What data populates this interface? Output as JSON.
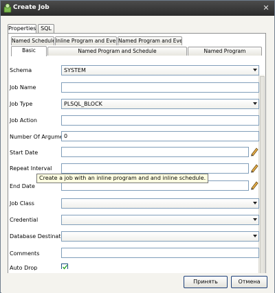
{
  "window": {
    "title": "Create Job",
    "close_symbol": "✕"
  },
  "top_tabs": [
    {
      "label": "Properties",
      "active": true
    },
    {
      "label": "SQL",
      "active": false
    }
  ],
  "inner_tabs_row1": [
    "Named Schedule",
    "Inline Program and Event",
    "Named Program and Event"
  ],
  "inner_tabs_row2": [
    {
      "label": "Basic",
      "active": true
    },
    {
      "label": "Named Program and Schedule",
      "active": false
    },
    {
      "label": "Named Program",
      "active": false
    }
  ],
  "form": {
    "schema": {
      "label": "Schema",
      "value": "SYSTEM"
    },
    "job_name": {
      "label": "Job Name",
      "value": ""
    },
    "job_type": {
      "label": "Job Type",
      "value": "PLSQL_BLOCK"
    },
    "job_action": {
      "label": "Job Action",
      "value": ""
    },
    "num_args": {
      "label": "Number Of Arguments",
      "value": "0"
    },
    "start_date": {
      "label": "Start Date",
      "value": ""
    },
    "repeat_interval": {
      "label": "Repeat Interval",
      "value": ""
    },
    "end_date": {
      "label": "End Date",
      "value": ""
    },
    "job_class": {
      "label": "Job Class",
      "value": ""
    },
    "credential": {
      "label": "Credential",
      "value": ""
    },
    "db_destination": {
      "label": "Database Destination",
      "value": ""
    },
    "comments": {
      "label": "Comments",
      "value": ""
    },
    "auto_drop": {
      "label": "Auto Drop",
      "checked": true
    }
  },
  "tooltip": "Create a job with an inline program and and inline schedule.",
  "buttons": {
    "ok": "Принять",
    "cancel": "Отмена"
  },
  "colors": {
    "titlebar": "#2b2b2b",
    "field_border": "#7f9db9",
    "tooltip_bg": "#ffffe1"
  }
}
